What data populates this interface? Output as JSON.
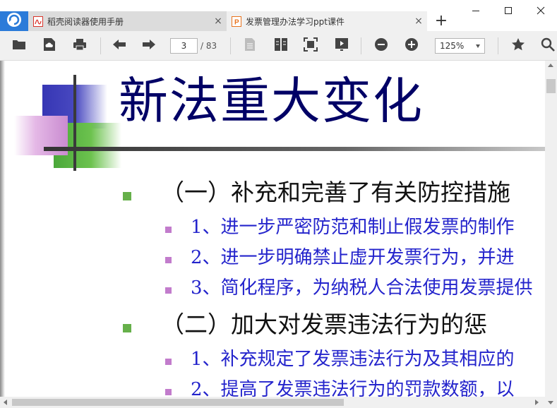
{
  "tabs": [
    {
      "label": "稻壳阅读器使用手册",
      "icon": "pdf-file-icon",
      "icon_color": "#d9342b"
    },
    {
      "label": "发票管理办法学习ppt课件",
      "icon": "ppt-file-icon",
      "icon_color": "#e8731e"
    }
  ],
  "tab_close_glyph": "×",
  "new_tab_glyph": "+",
  "toolbar": {
    "current_page": "3",
    "total_pages": "/ 83",
    "zoom": "125%"
  },
  "slide": {
    "title": "新法重大变化",
    "sections": [
      {
        "heading": "（一）补充和完善了有关防控措施",
        "items": [
          "1、进一步严密防范和制止假发票的制作",
          "2、进一步明确禁止虚开发票行为，并进",
          "3、简化程序，为纳税人合法使用发票提供"
        ]
      },
      {
        "heading": "（二）加大对发票违法行为的惩",
        "items": [
          "1、补充规定了发票违法行为及其相应的",
          "2、提高了发票违法行为的罚款数额，以"
        ]
      }
    ]
  },
  "colors": {
    "accent": "#2b7bd9",
    "title_text": "#000066",
    "sub_item_text": "#2424cc",
    "bullet_green": "#66b04a",
    "bullet_purple": "#c27ccc"
  }
}
